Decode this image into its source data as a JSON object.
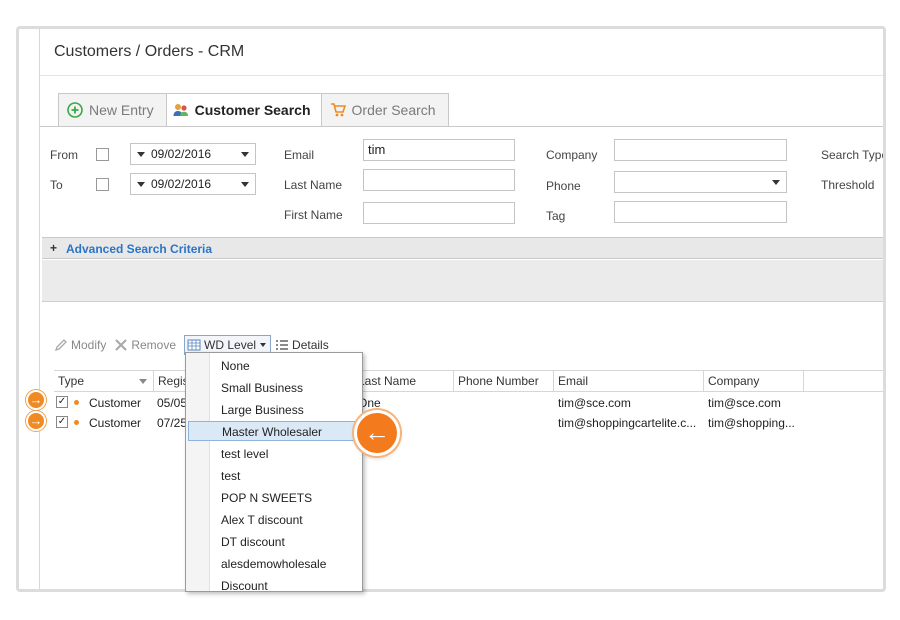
{
  "app": {
    "title": "Customers / Orders - CRM"
  },
  "tabs": [
    {
      "label": "New Entry",
      "icon": "plus-circle-icon"
    },
    {
      "label": "Customer Search",
      "icon": "users-icon"
    },
    {
      "label": "Order Search",
      "icon": "cart-icon"
    }
  ],
  "search": {
    "from_label": "From",
    "to_label": "To",
    "from_date": "09/02/2016",
    "to_date": "09/02/2016",
    "email_label": "Email",
    "email_value": "tim",
    "lastname_label": "Last Name",
    "lastname_value": "",
    "firstname_label": "First Name",
    "firstname_value": "",
    "company_label": "Company",
    "company_value": "",
    "phone_label": "Phone",
    "phone_value": "",
    "tag_label": "Tag",
    "tag_value": "",
    "search_type_label": "Search Type",
    "threshold_label": "Threshold"
  },
  "advanced": {
    "label": "Advanced Search Criteria",
    "expand": "+"
  },
  "toolbar": {
    "modify": "Modify",
    "remove": "Remove",
    "wd_level": "WD Level",
    "details": "Details"
  },
  "grid": {
    "columns": [
      "Type",
      "Regis",
      "Last Name",
      "Phone Number",
      "Email",
      "Company"
    ],
    "rows": [
      {
        "checked": "✓",
        "type": "Customer",
        "reg": "05/05",
        "last_name": "One",
        "phone": "",
        "email": "tim@sce.com",
        "company": "tim@sce.com"
      },
      {
        "checked": "✓",
        "type": "Customer",
        "reg": "07/25",
        "last_name": "",
        "phone": "",
        "email": "tim@shoppingcartelite.c...",
        "company": "tim@shopping..."
      }
    ]
  },
  "wd_dropdown": {
    "items": [
      "None",
      "Small Business",
      "Large Business",
      "Master Wholesaler",
      "test level",
      "test",
      "POP N SWEETS",
      "Alex T discount",
      "DT discount",
      "alesdemowholesale",
      "Discount"
    ],
    "selected": "Master Wholesaler"
  },
  "colors": {
    "accent_orange": "#f37b1d",
    "link_blue": "#2b74c7",
    "selection_bg": "#dbe9f7"
  }
}
